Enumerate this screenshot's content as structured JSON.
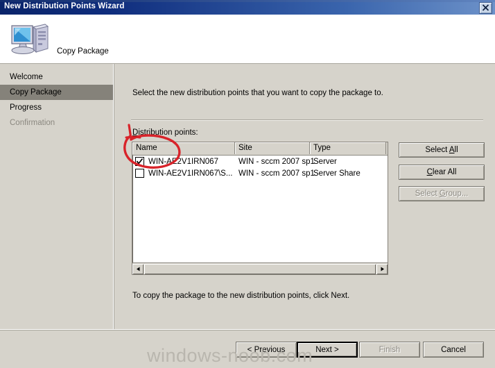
{
  "window": {
    "title": "New Distribution Points Wizard",
    "close_icon": "close-icon"
  },
  "header": {
    "icon": "computer-icon",
    "title": "Copy Package"
  },
  "sidebar": {
    "items": [
      {
        "label": "Welcome",
        "state": "normal"
      },
      {
        "label": "Copy Package",
        "state": "active"
      },
      {
        "label": "Progress",
        "state": "normal"
      },
      {
        "label": "Confirmation",
        "state": "disabled"
      }
    ]
  },
  "main": {
    "intro": "Select the new distribution points that you want to copy the package to.",
    "list_label": "Distribution points:",
    "list_label_accel": "D",
    "list_label_rest": "istribution points:",
    "footer": "To copy the package to the new distribution points, click Next.",
    "columns": [
      "Name",
      "Site",
      "Type"
    ],
    "rows": [
      {
        "checked": true,
        "name": "WIN-AE2V1IRN067",
        "site": "WIN - sccm 2007 sp1",
        "type": "Server"
      },
      {
        "checked": false,
        "name": "WIN-AE2V1IRN067\\S...",
        "site": "WIN - sccm 2007 sp1",
        "type": "Server Share"
      }
    ],
    "side_buttons": [
      {
        "label": "Select All",
        "accel_before": "Select ",
        "accel": "A",
        "accel_after": "ll",
        "enabled": true
      },
      {
        "label": "Clear All",
        "accel_before": "C",
        "accel": "",
        "accel_after": "lear All",
        "enabled": true
      },
      {
        "label": "Select Group...",
        "accel_before": "Select ",
        "accel": "G",
        "accel_after": "roup...",
        "enabled": false
      }
    ],
    "scrollbar": {
      "left_arrow_icon": "triangle-left-icon",
      "right_arrow_icon": "triangle-right-icon"
    }
  },
  "buttons": {
    "previous": {
      "label": "< Previous",
      "enabled": true,
      "default": false
    },
    "next": {
      "label": "Next >",
      "enabled": true,
      "default": true
    },
    "finish": {
      "label": "Finish",
      "enabled": false,
      "default": false
    },
    "cancel": {
      "label": "Cancel",
      "enabled": true,
      "default": false
    }
  },
  "watermark": {
    "text": "windows-noob.com"
  },
  "colors": {
    "titlebar_start": "#0a246a",
    "titlebar_end": "#6d92c9",
    "dialog_face": "#d6d3cb",
    "nav_active": "#85827a",
    "disabled_text": "#8b8880",
    "annotation": "#d8232a",
    "watermark": "#b9b6ae"
  }
}
